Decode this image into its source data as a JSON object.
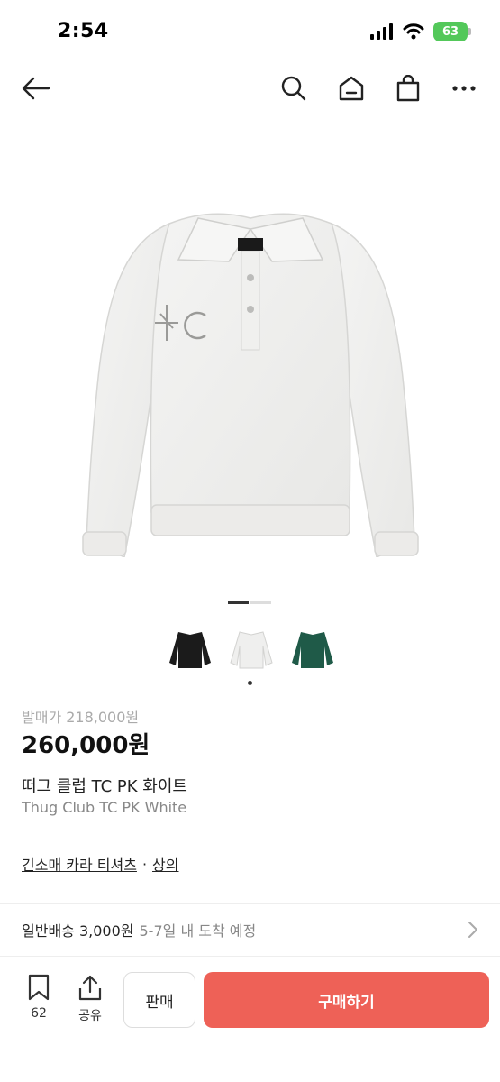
{
  "status": {
    "time": "2:54",
    "battery": "63"
  },
  "colors": {
    "accent": "#ee6157",
    "muted": "#888888",
    "status_battery": "#53c85a"
  },
  "nav": {
    "back_icon": "arrow-left-icon",
    "search_icon": "search-icon",
    "home_icon": "home-icon",
    "bag_icon": "shopping-bag-icon",
    "more_icon": "more-horizontal-icon"
  },
  "gallery": {
    "current_page": 1,
    "page_count": 2,
    "thumbnails": [
      {
        "name": "black",
        "color": "#1b1b1b"
      },
      {
        "name": "white",
        "color": "#efefee"
      },
      {
        "name": "green",
        "color": "#1f5a48"
      }
    ],
    "selected_thumbnail": 2
  },
  "product": {
    "original_price": "발매가 218,000원",
    "price": "260,000원",
    "title_ko": "떠그 클럽 TC PK 화이트",
    "title_en": "Thug Club TC PK White"
  },
  "categories": {
    "primary": "긴소매 카라 티셔츠",
    "separator": "·",
    "secondary": "상의"
  },
  "shipping": {
    "fee": "일반배송 3,000원",
    "eta": "5-7일 내 도착 예정"
  },
  "bottom": {
    "bookmark_count": "62",
    "share_label": "공유",
    "sell_label": "판매",
    "buy_label": "구매하기"
  }
}
